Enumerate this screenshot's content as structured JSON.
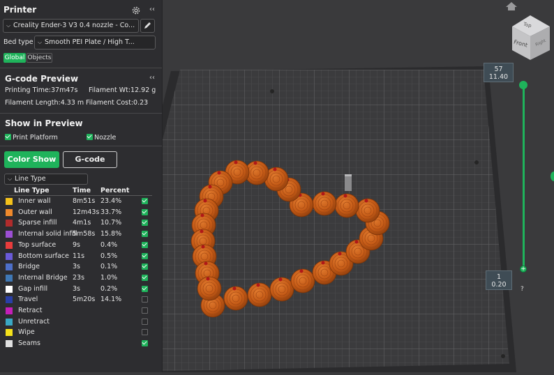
{
  "printer": {
    "title": "Printer",
    "preset": "Creality Ender-3 V3 0.4 nozzle - Co...",
    "bed_type_label": "Bed type",
    "bed_type": "Smooth PEI Plate / High T...",
    "tabs": [
      "Global",
      "Objects"
    ]
  },
  "preview": {
    "title": "G-code Preview",
    "printing_time": "Printing Time:37m47s",
    "filament_wt": "Filament Wt:12.92 g",
    "filament_length": "Filament Length:4.33 m",
    "filament_cost": "Filament Cost:0.23"
  },
  "show": {
    "title": "Show in Preview",
    "print_platform": "Print Platform",
    "nozzle": "Nozzle",
    "color_show": "Color Show",
    "gcode": "G-code",
    "view_select": "Line Type"
  },
  "table": {
    "headers": [
      "Line Type",
      "Time",
      "Percent"
    ],
    "rows": [
      {
        "label": "Inner wall",
        "time": "8m51s",
        "percent": "23.4%",
        "color": "#f5c21b",
        "checked": true
      },
      {
        "label": "Outer wall",
        "time": "12m43s",
        "percent": "33.7%",
        "color": "#f08a2c",
        "checked": true
      },
      {
        "label": "Sparse infill",
        "time": "4m1s",
        "percent": "10.7%",
        "color": "#b02c2c",
        "checked": true
      },
      {
        "label": "Internal solid infill",
        "time": "5m58s",
        "percent": "15.8%",
        "color": "#9c4fd4",
        "checked": true
      },
      {
        "label": "Top surface",
        "time": "9s",
        "percent": "0.4%",
        "color": "#e83c3c",
        "checked": true
      },
      {
        "label": "Bottom surface",
        "time": "11s",
        "percent": "0.5%",
        "color": "#6a5ad8",
        "checked": true
      },
      {
        "label": "Bridge",
        "time": "3s",
        "percent": "0.1%",
        "color": "#4d6fc8",
        "checked": true
      },
      {
        "label": "Internal Bridge",
        "time": "23s",
        "percent": "1.0%",
        "color": "#3f78b5",
        "checked": true
      },
      {
        "label": "Gap infill",
        "time": "3s",
        "percent": "0.2%",
        "color": "#ffffff",
        "checked": true
      },
      {
        "label": "Travel",
        "time": "5m20s",
        "percent": "14.1%",
        "color": "#2a3fa8",
        "checked": false
      },
      {
        "label": "Retract",
        "time": "",
        "percent": "",
        "color": "#c41fb8",
        "checked": false
      },
      {
        "label": "Unretract",
        "time": "",
        "percent": "",
        "color": "#3aa8c4",
        "checked": false
      },
      {
        "label": "Wipe",
        "time": "",
        "percent": "",
        "color": "#f5e21b",
        "checked": false
      },
      {
        "label": "Seams",
        "time": "",
        "percent": "",
        "color": "#e0e0e0",
        "checked": true
      }
    ]
  },
  "layer_slider": {
    "top_layer": "57",
    "top_height": "11.40",
    "bottom_layer": "1",
    "bottom_height": "0.20",
    "help": "?"
  },
  "view_cube": {
    "top": "Top",
    "front": "Front",
    "right": "Right"
  },
  "colors": {
    "accent": "#1fb35b",
    "panel": "#2d2d30",
    "viewport": "#3a3a3c"
  },
  "collapse_glyph": "‹‹"
}
